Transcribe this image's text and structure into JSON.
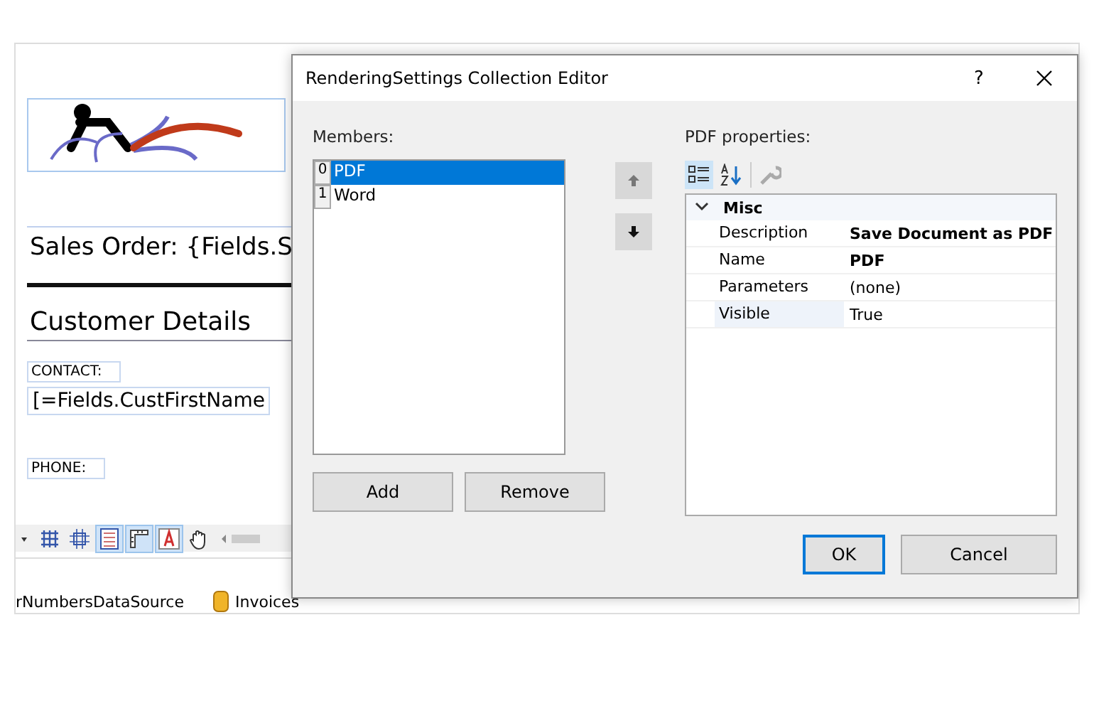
{
  "designer": {
    "report_title": "Sales Order: {Fields.S",
    "section_heading": "Customer Details",
    "contact_label": "CONTACT:",
    "contact_field": "[=Fields.CustFirstName",
    "phone_label": "PHONE:",
    "toolbar": [
      {
        "kind": "dropdown",
        "selected": false
      },
      {
        "kind": "grid",
        "selected": false
      },
      {
        "kind": "snap",
        "selected": false
      },
      {
        "kind": "lines",
        "selected": true
      },
      {
        "kind": "ruler",
        "selected": true
      },
      {
        "kind": "text",
        "selected": true
      },
      {
        "kind": "hand",
        "selected": false
      },
      {
        "kind": "scroll",
        "selected": false
      }
    ],
    "data_sources": [
      {
        "name": "rNumbersDataSource",
        "kind": "plain"
      },
      {
        "name": "Invoices",
        "kind": "database"
      }
    ]
  },
  "dialog": {
    "title": "RenderingSettings Collection Editor",
    "help": "?",
    "members_label": "Members:",
    "members": [
      {
        "index": "0",
        "name": "PDF",
        "selected": true
      },
      {
        "index": "1",
        "name": "Word",
        "selected": false
      }
    ],
    "add": "Add",
    "remove": "Remove",
    "properties_label": "PDF properties:",
    "category": {
      "name": "Misc",
      "expanded": true,
      "properties": [
        {
          "name": "Description",
          "value": "Save Document as PDF",
          "modified": true,
          "selected": false
        },
        {
          "name": "Name",
          "value": "PDF",
          "modified": true,
          "selected": false
        },
        {
          "name": "Parameters",
          "value": "(none)",
          "modified": false,
          "selected": false
        },
        {
          "name": "Visible",
          "value": "True",
          "modified": false,
          "selected": true
        }
      ]
    },
    "ok": "OK",
    "cancel": "Cancel"
  }
}
